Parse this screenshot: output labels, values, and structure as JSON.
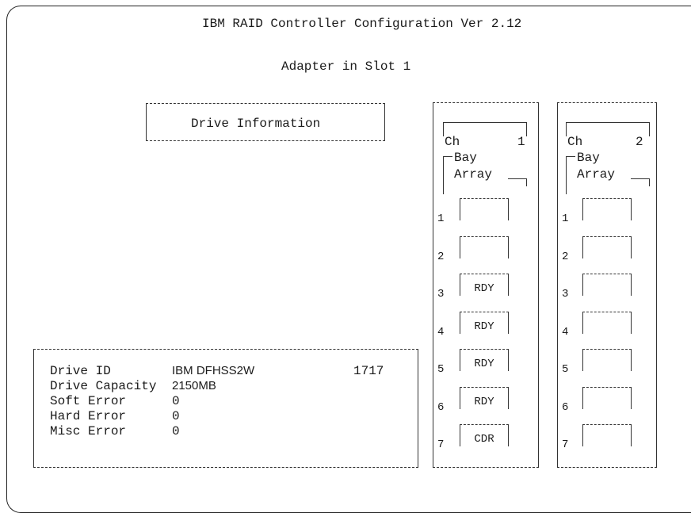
{
  "header": {
    "title": "IBM RAID Controller Configuration Ver 2.12",
    "subtitle": "Adapter in Slot 1"
  },
  "drive_info_panel": {
    "title": "Drive Information"
  },
  "details": {
    "drive_id_label": "Drive ID",
    "drive_id_value": "IBM DFHSS2W",
    "drive_id_rev": "1717",
    "capacity_label": "Drive Capacity",
    "capacity_value": "2150MB",
    "soft_error_label": "Soft Error",
    "soft_error_value": "0",
    "hard_error_label": "Hard Error",
    "hard_error_value": "0",
    "misc_error_label": "Misc Error",
    "misc_error_value": "0"
  },
  "channels": [
    {
      "ch_label": "Ch",
      "ch_number": "1",
      "bay_label": "Bay",
      "array_label": "Array",
      "bays": [
        {
          "number": "1",
          "status": ""
        },
        {
          "number": "2",
          "status": ""
        },
        {
          "number": "3",
          "status": "RDY"
        },
        {
          "number": "4",
          "status": "RDY"
        },
        {
          "number": "5",
          "status": "RDY"
        },
        {
          "number": "6",
          "status": "RDY"
        },
        {
          "number": "7",
          "status": "CDR"
        }
      ]
    },
    {
      "ch_label": "Ch",
      "ch_number": "2",
      "bay_label": "Bay",
      "array_label": "Array",
      "bays": [
        {
          "number": "1",
          "status": ""
        },
        {
          "number": "2",
          "status": ""
        },
        {
          "number": "3",
          "status": ""
        },
        {
          "number": "4",
          "status": ""
        },
        {
          "number": "5",
          "status": ""
        },
        {
          "number": "6",
          "status": ""
        },
        {
          "number": "7",
          "status": ""
        }
      ]
    }
  ]
}
